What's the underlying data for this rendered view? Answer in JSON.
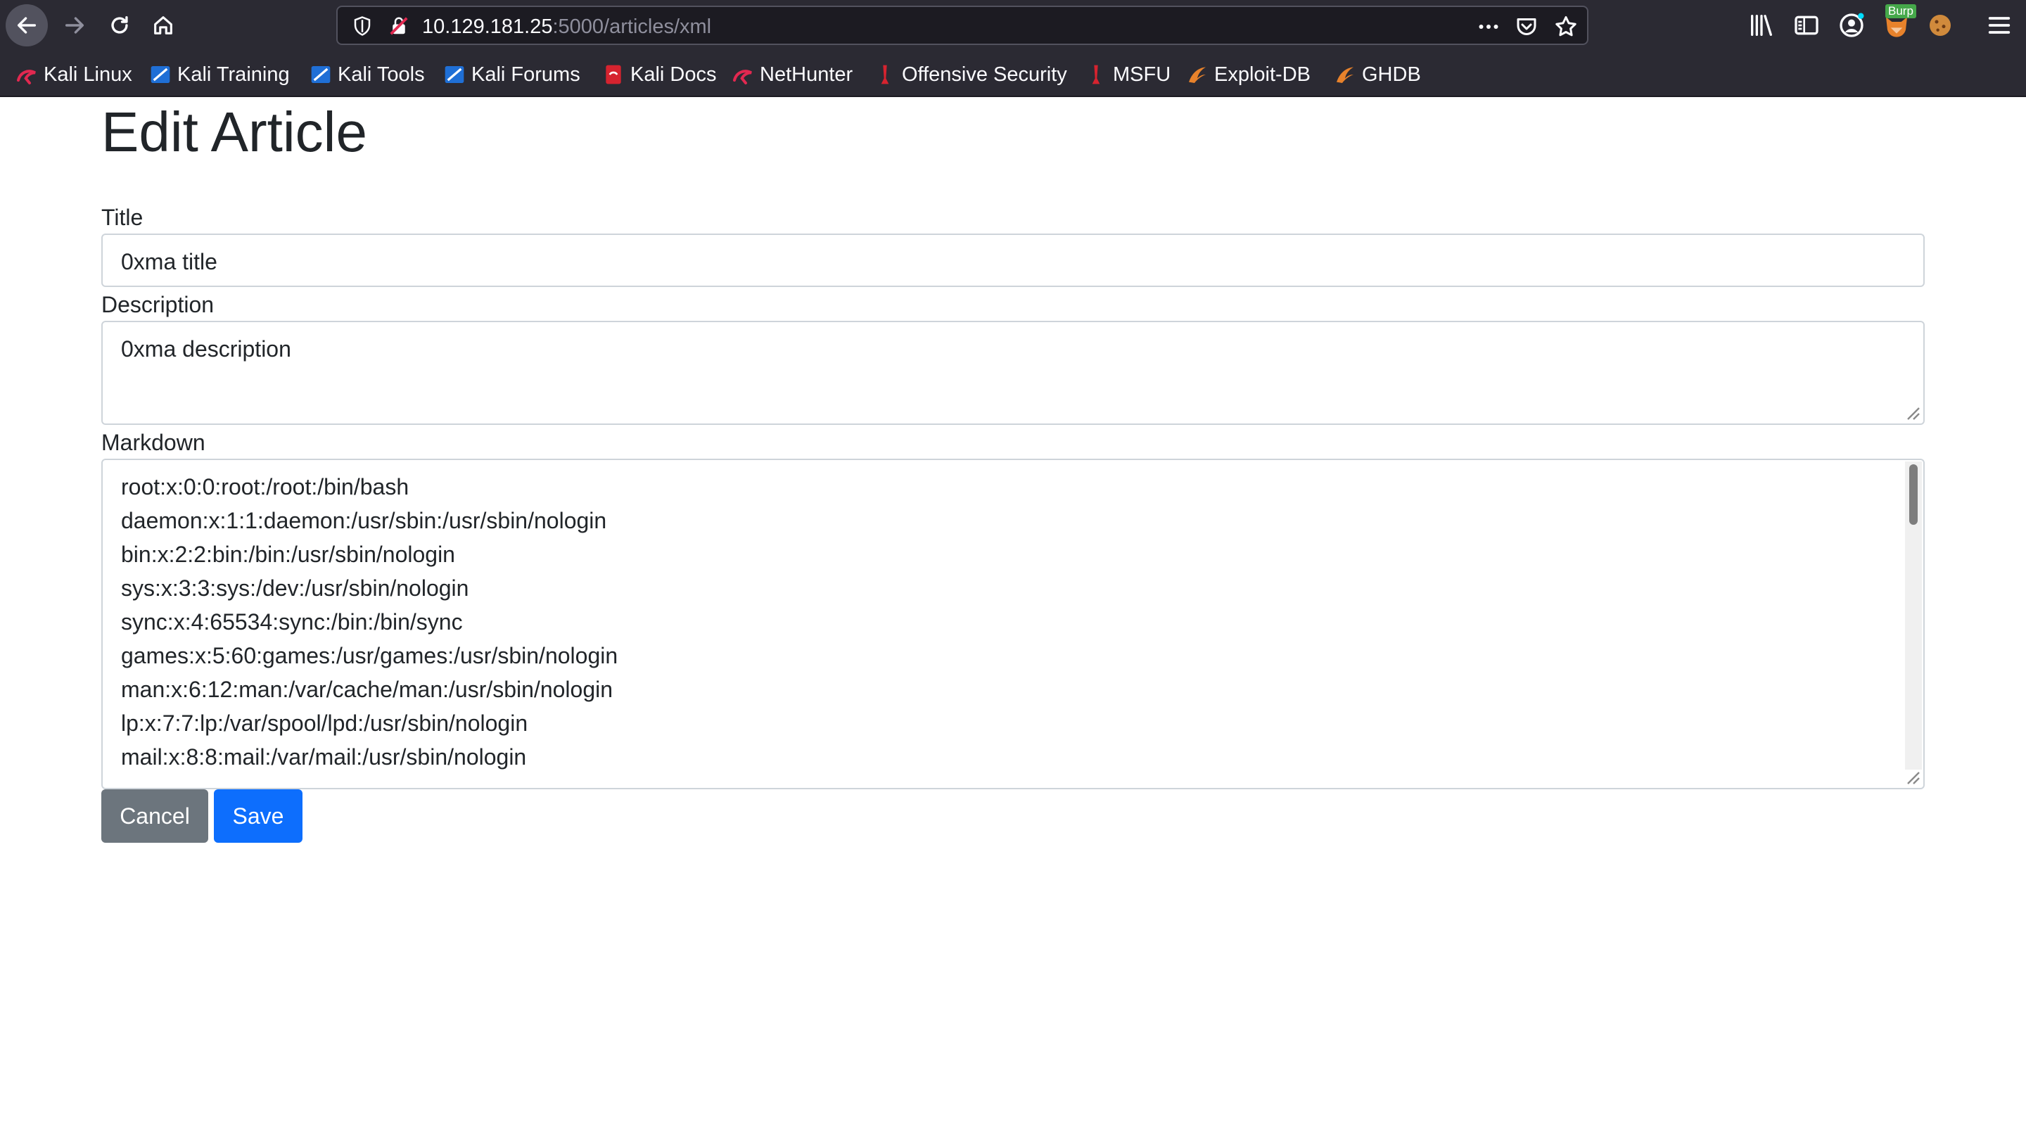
{
  "browser": {
    "url_host": "10.129.181.25",
    "url_path": ":5000/articles/xml",
    "burp_badge": "Burp",
    "bookmarks": [
      {
        "label": "Kali Linux",
        "icon": "kali-dragon-icon"
      },
      {
        "label": "Kali Training",
        "icon": "kali-blue-icon"
      },
      {
        "label": "Kali Tools",
        "icon": "kali-blue-icon"
      },
      {
        "label": "Kali Forums",
        "icon": "kali-blue-icon"
      },
      {
        "label": "Kali Docs",
        "icon": "kali-docs-icon"
      },
      {
        "label": "NetHunter",
        "icon": "kali-dragon-icon"
      },
      {
        "label": "Offensive Security",
        "icon": "offsec-icon"
      },
      {
        "label": "MSFU",
        "icon": "offsec-icon"
      },
      {
        "label": "Exploit-DB",
        "icon": "exploitdb-icon"
      },
      {
        "label": "GHDB",
        "icon": "exploitdb-icon"
      }
    ]
  },
  "page": {
    "heading": "Edit Article",
    "title_label": "Title",
    "title_value": "0xma title",
    "description_label": "Description",
    "description_value": "0xma description",
    "markdown_label": "Markdown",
    "markdown_lines": [
      "root:x:0:0:root:/root:/bin/bash",
      "daemon:x:1:1:daemon:/usr/sbin:/usr/sbin/nologin",
      "bin:x:2:2:bin:/bin:/usr/sbin/nologin",
      "sys:x:3:3:sys:/dev:/usr/sbin/nologin",
      "sync:x:4:65534:sync:/bin:/bin/sync",
      "games:x:5:60:games:/usr/games:/usr/sbin/nologin",
      "man:x:6:12:man:/var/cache/man:/usr/sbin/nologin",
      "lp:x:7:7:lp:/var/spool/lpd:/usr/sbin/nologin",
      "mail:x:8:8:mail:/var/mail:/usr/sbin/nologin"
    ],
    "cancel_label": "Cancel",
    "save_label": "Save"
  },
  "colors": {
    "chrome_bg": "#2b2a33",
    "urlbar_bg": "#1c1b22",
    "cancel_bg": "#6c757d",
    "save_bg": "#0d6efd"
  }
}
